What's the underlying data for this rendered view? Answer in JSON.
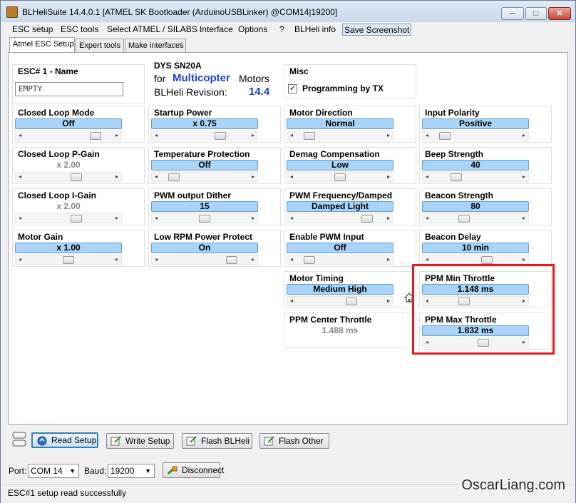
{
  "window": {
    "title": "BLHeliSuite 14.4.0.1  [ATMEL SK Bootloader (ArduinoUSBLinker) @COM14|19200]",
    "minimize": "─",
    "maximize": "□",
    "close": "✕"
  },
  "menu": {
    "items": [
      "ESC setup",
      "ESC tools",
      "Select ATMEL / SILABS Interface",
      "Options",
      "?",
      "BLHeli info",
      "Save Screenshot"
    ]
  },
  "tabs": [
    "Atmel ESC Setup",
    "Expert tools",
    "Make interfaces"
  ],
  "esc_name": {
    "label": "ESC# 1 - Name",
    "value": "EMPTY"
  },
  "esc_info": {
    "model": "DYS SN20A",
    "for_text": "for",
    "mode": "Multicopter",
    "motors_text": "Motors",
    "revision_label": "BLHeli Revision:",
    "revision": "14.4"
  },
  "misc": {
    "label": "Misc",
    "programming_by_tx": "Programming by TX",
    "programming_checked": true
  },
  "settings": {
    "closed_loop_mode": {
      "label": "Closed Loop Mode",
      "value": "Off",
      "level": 0.85
    },
    "startup_power": {
      "label": "Startup Power",
      "value": "x 0.75",
      "level": 0.7
    },
    "motor_direction": {
      "label": "Motor Direction",
      "value": "Normal",
      "level": 0.1
    },
    "input_polarity": {
      "label": "Input Polarity",
      "value": "Positive",
      "level": 0.1
    },
    "closed_loop_p_gain": {
      "label": "Closed Loop P-Gain",
      "value": "x 2.00",
      "level": 0.6
    },
    "temperature_protection": {
      "label": "Temperature Protection",
      "value": "Off",
      "level": 0.1
    },
    "demag_compensation": {
      "label": "Demag Compensation",
      "value": "Low",
      "level": 0.5
    },
    "beep_strength": {
      "label": "Beep Strength",
      "value": "40",
      "level": 0.25
    },
    "closed_loop_i_gain": {
      "label": "Closed Loop I-Gain",
      "value": "x 2.00",
      "level": 0.6
    },
    "pwm_output_dither": {
      "label": "PWM output Dither",
      "value": "15",
      "level": 0.5
    },
    "pwm_frequency": {
      "label": "PWM Frequency/Damped",
      "value": "Damped Light",
      "level": 0.85
    },
    "beacon_strength": {
      "label": "Beacon Strength",
      "value": "80",
      "level": 0.35
    },
    "motor_gain": {
      "label": "Motor Gain",
      "value": "x 1.00",
      "level": 0.5
    },
    "low_rpm_power_protect": {
      "label": "Low RPM Power Protect",
      "value": "On",
      "level": 0.85
    },
    "enable_pwm_input": {
      "label": "Enable PWM Input",
      "value": "Off",
      "level": 0.1
    },
    "beacon_delay": {
      "label": "Beacon Delay",
      "value": "10 min",
      "level": 0.65
    },
    "motor_timing": {
      "label": "Motor Timing",
      "value": "Medium High",
      "level": 0.65
    },
    "ppm_min_throttle": {
      "label": "PPM Min Throttle",
      "value": "1.148 ms",
      "level": 0.35
    },
    "ppm_center_throttle": {
      "label": "PPM Center Throttle",
      "value": "1.488 ms"
    },
    "ppm_max_throttle": {
      "label": "PPM Max Throttle",
      "value": "1.832 ms",
      "level": 0.6
    }
  },
  "buttons": {
    "read_setup": "Read Setup",
    "write_setup": "Write Setup",
    "flash_blheli": "Flash BLHeli",
    "flash_other": "Flash Other",
    "disconnect": "Disconnect"
  },
  "connection": {
    "port_label": "Port:",
    "port": "COM 14",
    "baud_label": "Baud:",
    "baud": "19200"
  },
  "status": {
    "text": "ESC#1 setup read successfully"
  },
  "watermark": "OscarLiang.com",
  "colors": {
    "value_box": "#a8d4fa",
    "highlight": "#e11b24",
    "revision": "#1a3fd0"
  }
}
